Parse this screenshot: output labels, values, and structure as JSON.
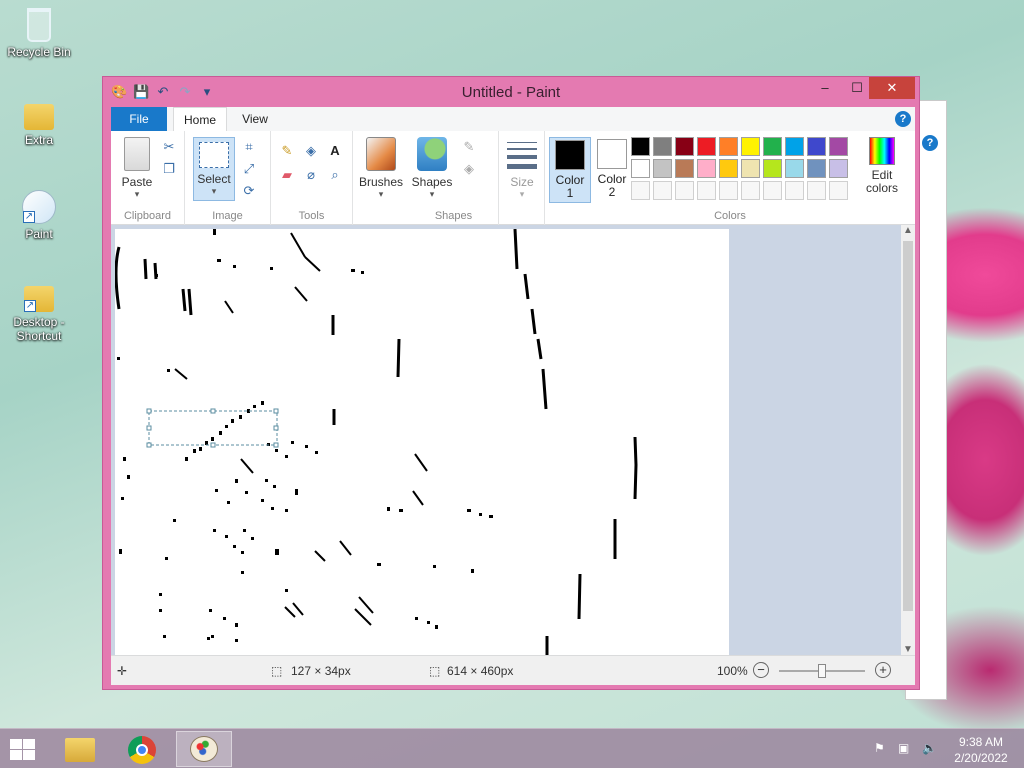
{
  "desktop": {
    "icons": [
      {
        "label": "Recycle Bin"
      },
      {
        "label": "Extra"
      },
      {
        "label": "Paint"
      },
      {
        "label": "Desktop -\nShortcut"
      }
    ]
  },
  "window": {
    "title": "Untitled - Paint",
    "controls": {
      "minimize": "–",
      "maximize": "☐",
      "close": "✕"
    }
  },
  "tabs": {
    "file": "File",
    "home": "Home",
    "view": "View"
  },
  "ribbon": {
    "clipboard": {
      "paste": "Paste",
      "group": "Clipboard"
    },
    "image": {
      "select": "Select",
      "group": "Image"
    },
    "tools": {
      "group": "Tools"
    },
    "shapes": {
      "brushes": "Brushes",
      "shapes": "Shapes",
      "group": "Shapes"
    },
    "size": {
      "label": "Size"
    },
    "colors": {
      "color1": "Color\n1",
      "color2": "Color\n2",
      "edit": "Edit\ncolors",
      "group": "Colors",
      "palette_row1": [
        "#000000",
        "#7f7f7f",
        "#880015",
        "#ed1c24",
        "#ff7f27",
        "#fff200",
        "#22b14c",
        "#00a2e8",
        "#3f48cc",
        "#a349a4"
      ],
      "palette_row2": [
        "#ffffff",
        "#c3c3c3",
        "#b97a57",
        "#ffaec9",
        "#ffc90e",
        "#efe4b0",
        "#b5e61d",
        "#99d9ea",
        "#7092be",
        "#c8bfe7"
      ],
      "color1_value": "#000000",
      "color2_value": "#ffffff"
    }
  },
  "statusbar": {
    "selection_size": "127 × 34px",
    "canvas_size": "614 × 460px",
    "zoom": "100%",
    "zoom_level": 0.5
  },
  "taskbar": {
    "time": "9:38 AM",
    "date": "2/20/2022"
  }
}
